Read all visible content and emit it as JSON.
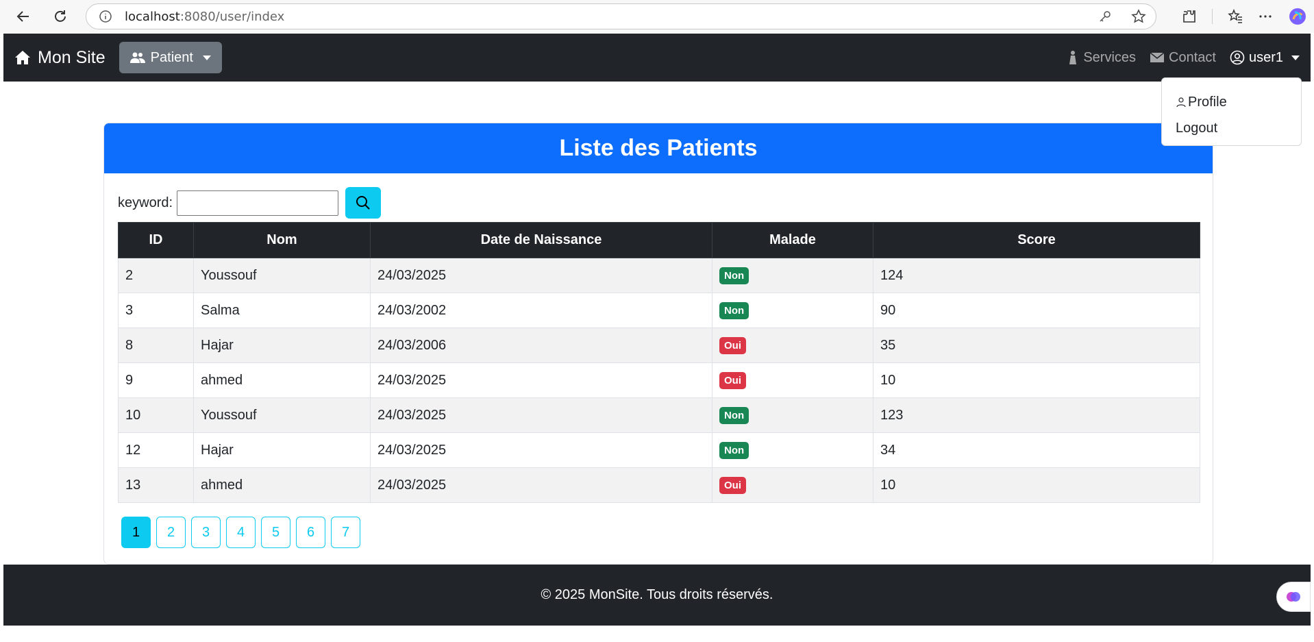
{
  "browser": {
    "url_host": "localhost",
    "url_path": ":8080/user/index"
  },
  "navbar": {
    "brand": "Mon Site",
    "patient_menu": "Patient",
    "services": "Services",
    "contact": "Contact",
    "user": "user1"
  },
  "user_dropdown": {
    "profile": "Profile",
    "logout": "Logout"
  },
  "card": {
    "title": "Liste des Patients",
    "search_label": "keyword:",
    "search_value": ""
  },
  "table": {
    "headers": [
      "ID",
      "Nom",
      "Date de Naissance",
      "Malade",
      "Score"
    ],
    "rows": [
      {
        "id": "2",
        "nom": "Youssouf",
        "date": "24/03/2025",
        "malade": "Non",
        "score": "124"
      },
      {
        "id": "3",
        "nom": "Salma",
        "date": "24/03/2002",
        "malade": "Non",
        "score": "90"
      },
      {
        "id": "8",
        "nom": "Hajar",
        "date": "24/03/2006",
        "malade": "Oui",
        "score": "35"
      },
      {
        "id": "9",
        "nom": "ahmed",
        "date": "24/03/2025",
        "malade": "Oui",
        "score": "10"
      },
      {
        "id": "10",
        "nom": "Youssouf",
        "date": "24/03/2025",
        "malade": "Non",
        "score": "123"
      },
      {
        "id": "12",
        "nom": "Hajar",
        "date": "24/03/2025",
        "malade": "Non",
        "score": "34"
      },
      {
        "id": "13",
        "nom": "ahmed",
        "date": "24/03/2025",
        "malade": "Oui",
        "score": "10"
      }
    ]
  },
  "pagination": {
    "pages": [
      "1",
      "2",
      "3",
      "4",
      "5",
      "6",
      "7"
    ],
    "current": "1"
  },
  "footer": {
    "text": "© 2025 MonSite. Tous droits réservés."
  },
  "colors": {
    "primary": "#0d6efd",
    "info": "#0dcaf0",
    "dark": "#212529",
    "success": "#198754",
    "danger": "#dc3545"
  }
}
